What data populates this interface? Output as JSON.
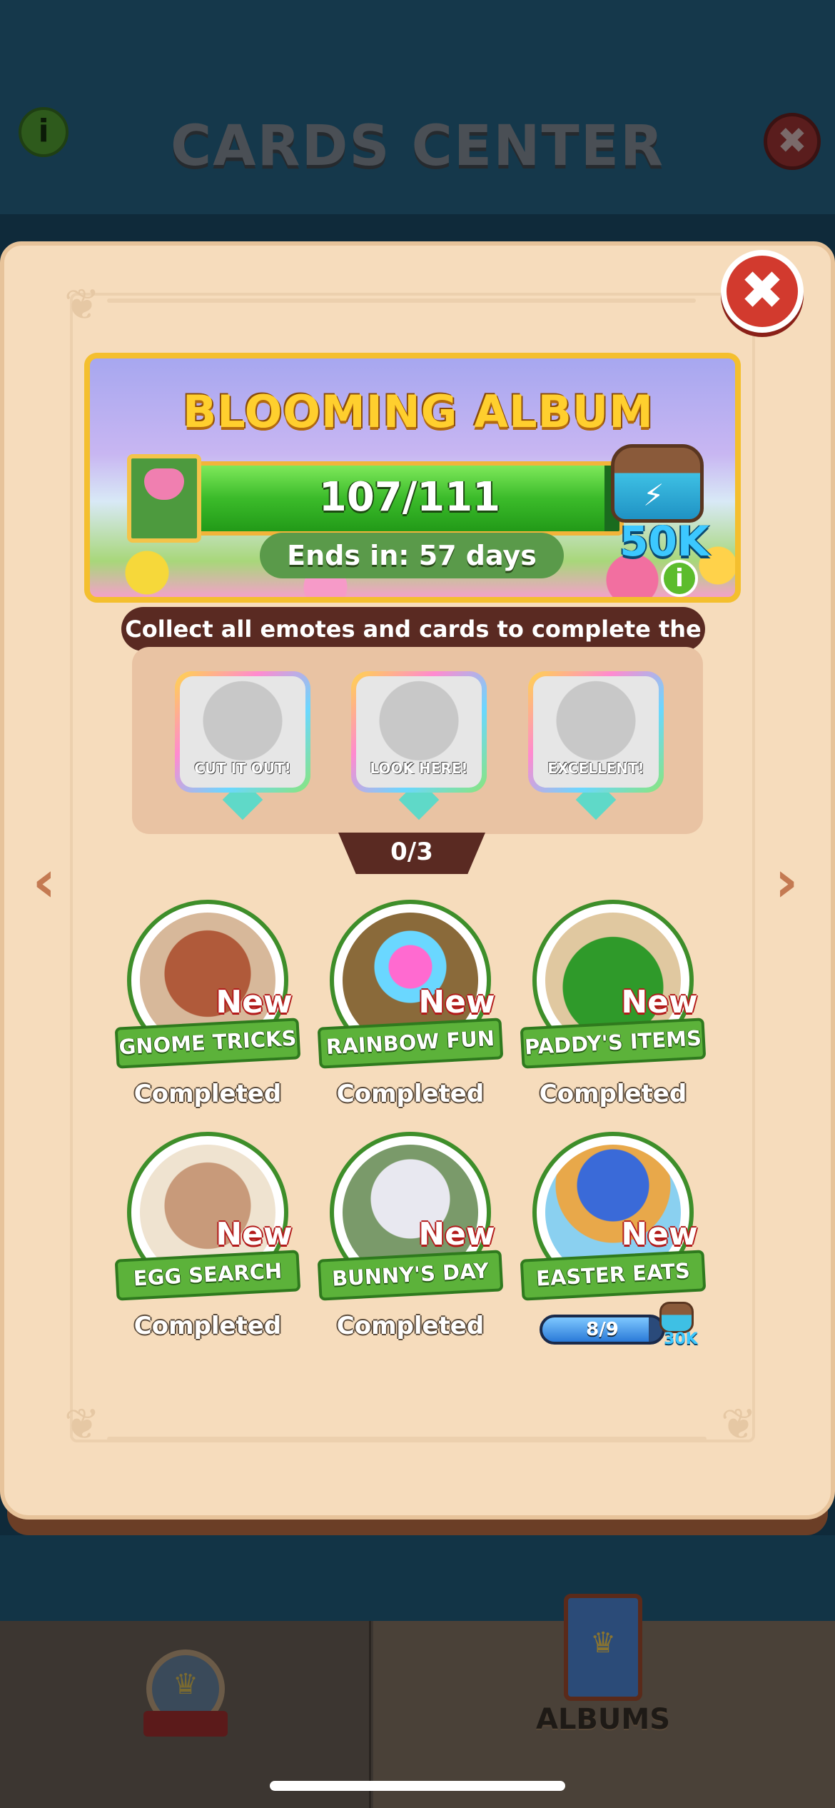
{
  "background": {
    "title": "CARDS CENTER",
    "info_icon": "i",
    "close_icon": "✖"
  },
  "modal": {
    "close_icon": "✖",
    "album": {
      "title": "BLOOMING ALBUM",
      "progress_text": "107/111",
      "progress_fraction": 0.964,
      "ends_in": "Ends in: 57 days",
      "reward_amount": "50K",
      "info_icon": "i"
    },
    "instruction": "Collect all emotes and cards to complete the album!",
    "emotes": [
      {
        "label": "CUT IT OUT!"
      },
      {
        "label": "LOOK HERE!"
      },
      {
        "label": "EXCELLENT!"
      }
    ],
    "emotes_count": "0/3",
    "prev_arrow": "‹",
    "next_arrow": "›",
    "sets": [
      {
        "name": "GNOME TRICKS",
        "badge": "New",
        "status": "Completed",
        "color": "#b05a3a"
      },
      {
        "name": "RAINBOW FUN",
        "badge": "New",
        "status": "Completed",
        "color": "#8a6a3a"
      },
      {
        "name": "PADDY'S ITEMS",
        "badge": "New",
        "status": "Completed",
        "color": "#3e8e2a"
      },
      {
        "name": "EGG SEARCH",
        "badge": "New",
        "status": "Completed",
        "color": "#c89a7a"
      },
      {
        "name": "BUNNY'S DAY",
        "badge": "New",
        "status": "Completed",
        "color": "#7a9a6a"
      },
      {
        "name": "EASTER EATS",
        "badge": "New",
        "progress_text": "8/9",
        "progress_fraction": 0.889,
        "reward_amount": "30K",
        "color": "#3a6ad8"
      }
    ]
  },
  "bottom_nav": {
    "albums_label": "ALBUMS"
  }
}
